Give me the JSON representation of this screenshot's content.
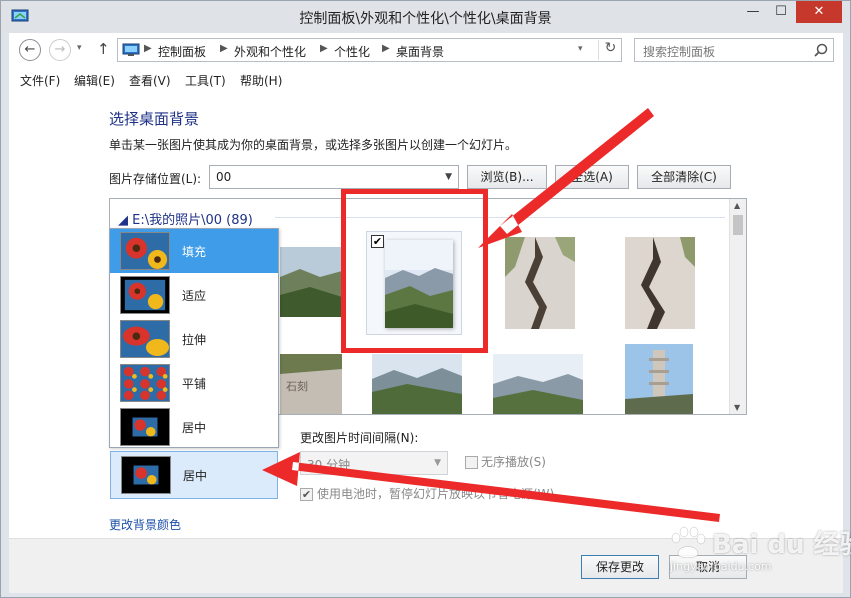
{
  "window": {
    "title": "控制面板\\外观和个性化\\个性化\\桌面背景",
    "minimize": "—",
    "maximize": "☐",
    "close": "✕"
  },
  "nav": {
    "back": "←",
    "forward": "→",
    "up": "↑",
    "breadcrumbs": [
      "控制面板",
      "外观和个性化",
      "个性化",
      "桌面背景"
    ],
    "search_placeholder": "搜索控制面板"
  },
  "menu": [
    "文件(F)",
    "编辑(E)",
    "查看(V)",
    "工具(T)",
    "帮助(H)"
  ],
  "main": {
    "heading": "选择桌面背景",
    "description": "单击某一张图片使其成为你的桌面背景，或选择多张图片以创建一个幻灯片。",
    "location_label": "图片存储位置(L):",
    "location_value": "00",
    "browse": "浏览(B)...",
    "select_all": "全选(A)",
    "clear_all": "全部清除(C)"
  },
  "gallery": {
    "group": "E:\\我的照片\\00 (89)",
    "checked": "✔"
  },
  "position_menu": {
    "items": [
      "填充",
      "适应",
      "拉伸",
      "平铺",
      "居中"
    ],
    "current": "居中"
  },
  "slideshow": {
    "interval_label": "更改图片时间间隔(N):",
    "interval_value": "30 分钟",
    "shuffle": "无序播放(S)",
    "battery": "使用电池时，暂停幻灯片放映以节省电源(W)"
  },
  "bgcolor_link": "更改背景颜色",
  "footer": {
    "save": "保存更改",
    "cancel": "取消"
  },
  "watermark": {
    "brand": "Bai du 经验",
    "url": "jingyan.baidu.com"
  },
  "colors": {
    "accent": "#3f9ce8",
    "heading": "#1e3287",
    "annotation": "#ec2a2a"
  }
}
